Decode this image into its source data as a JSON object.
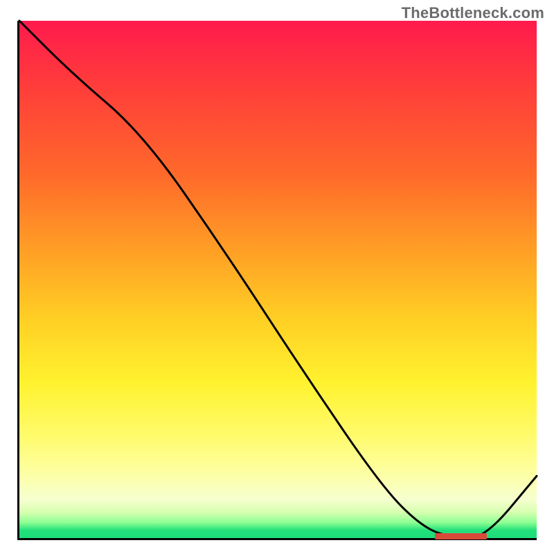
{
  "attribution": "TheBottleneck.com",
  "chart_data": {
    "type": "line",
    "title": "",
    "xlabel": "",
    "ylabel": "",
    "xlim": [
      0,
      100
    ],
    "ylim": [
      0,
      100
    ],
    "series": [
      {
        "name": "curve",
        "x": [
          0,
          10,
          24,
          40,
          55,
          70,
          78,
          84,
          90,
          100
        ],
        "y": [
          100,
          90,
          78,
          55,
          32,
          10,
          2,
          0,
          0,
          12
        ]
      }
    ],
    "marker": {
      "x_start": 80,
      "x_end": 90,
      "y": 0
    },
    "gradient_stops": [
      {
        "pos": 0,
        "color": "#ff1a4d"
      },
      {
        "pos": 0.45,
        "color": "#ffa125"
      },
      {
        "pos": 0.7,
        "color": "#fff22f"
      },
      {
        "pos": 0.95,
        "color": "#d7ffb0"
      },
      {
        "pos": 1.0,
        "color": "#1edc7b"
      }
    ]
  }
}
